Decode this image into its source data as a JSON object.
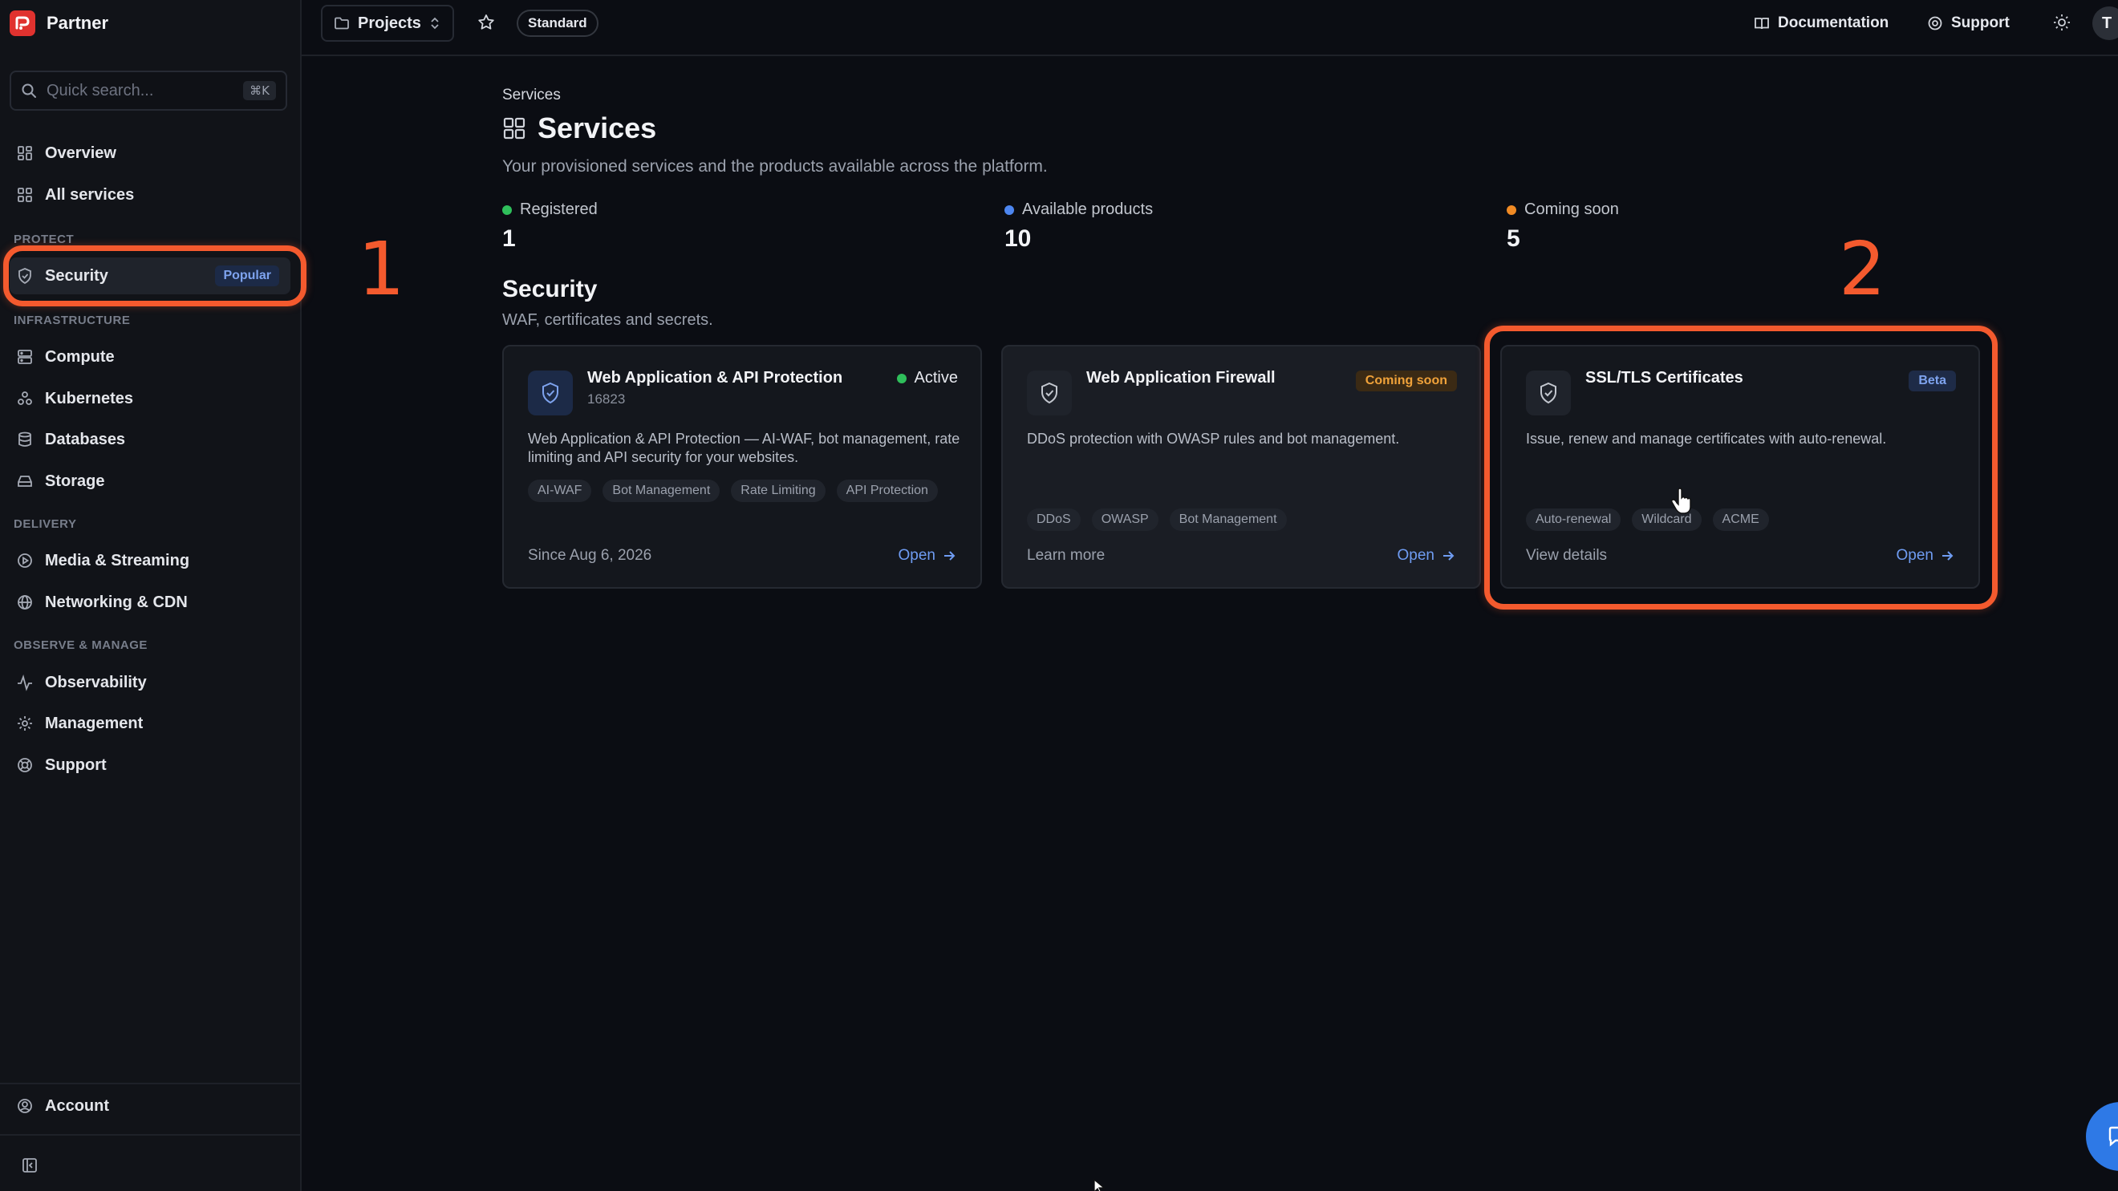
{
  "app": {
    "name": "Partner"
  },
  "sidebar": {
    "search_placeholder": "Quick search...",
    "search_shortcut": "⌘K",
    "top_items": [
      {
        "label": "Overview",
        "icon": "grid-icon"
      },
      {
        "label": "All services",
        "icon": "apps-icon"
      }
    ],
    "sections": [
      {
        "title": "PROTECT",
        "items": [
          {
            "label": "Security",
            "icon": "shield-icon",
            "badge": "Popular",
            "active": true
          }
        ]
      },
      {
        "title": "INFRASTRUCTURE",
        "items": [
          {
            "label": "Compute",
            "icon": "server-icon"
          },
          {
            "label": "Kubernetes",
            "icon": "kubernetes-icon"
          },
          {
            "label": "Databases",
            "icon": "database-icon"
          },
          {
            "label": "Storage",
            "icon": "storage-icon"
          }
        ]
      },
      {
        "title": "DELIVERY",
        "items": [
          {
            "label": "Media & Streaming",
            "icon": "play-icon"
          },
          {
            "label": "Networking & CDN",
            "icon": "globe-icon"
          }
        ]
      },
      {
        "title": "OBSERVE & MANAGE",
        "items": [
          {
            "label": "Observability",
            "icon": "activity-icon"
          },
          {
            "label": "Management",
            "icon": "gear-icon"
          },
          {
            "label": "Support",
            "icon": "lifebuoy-icon"
          }
        ]
      }
    ],
    "account_label": "Account"
  },
  "topbar": {
    "project_label": "Projects",
    "plan_badge": "Standard",
    "documentation_label": "Documentation",
    "support_label": "Support",
    "avatar_initial": "T"
  },
  "main": {
    "breadcrumb": "Services",
    "title": "Services",
    "description": "Your provisioned services and the products available across the platform.",
    "stats": [
      {
        "label": "Registered",
        "value": "1",
        "color": "#2fbf5b"
      },
      {
        "label": "Available products",
        "value": "10",
        "color": "#4d86f0"
      },
      {
        "label": "Coming soon",
        "value": "5",
        "color": "#f08a24"
      }
    ],
    "section": {
      "title": "Security",
      "description": "WAF, certificates and secrets."
    },
    "cards": [
      {
        "title": "Web Application & API Protection",
        "subtitle": "16823",
        "status": "Active",
        "description": "Web Application & API Protection — AI-WAF, bot management, rate limiting and API security for your websites.",
        "tags": [
          "AI-WAF",
          "Bot Management",
          "Rate Limiting",
          "API Protection"
        ],
        "footer": "Since Aug 6, 2026",
        "action": "Open"
      },
      {
        "title": "Web Application Firewall",
        "badge": "Coming soon",
        "description": "DDoS protection with OWASP rules and bot management.",
        "tags": [
          "DDoS",
          "OWASP",
          "Bot Management"
        ],
        "footer": "Learn more",
        "action": "Open"
      },
      {
        "title": "SSL/TLS Certificates",
        "badge": "Beta",
        "description": "Issue, renew and manage certificates with auto-renewal.",
        "tags": [
          "Auto-renewal",
          "Wildcard",
          "ACME"
        ],
        "footer": "View details",
        "action": "Open"
      }
    ]
  },
  "annotations": {
    "first": "1",
    "second": "2"
  },
  "colors": {
    "accent": "#6f9cf2",
    "annotation": "#f45a2e",
    "brand": "#e0322f"
  }
}
